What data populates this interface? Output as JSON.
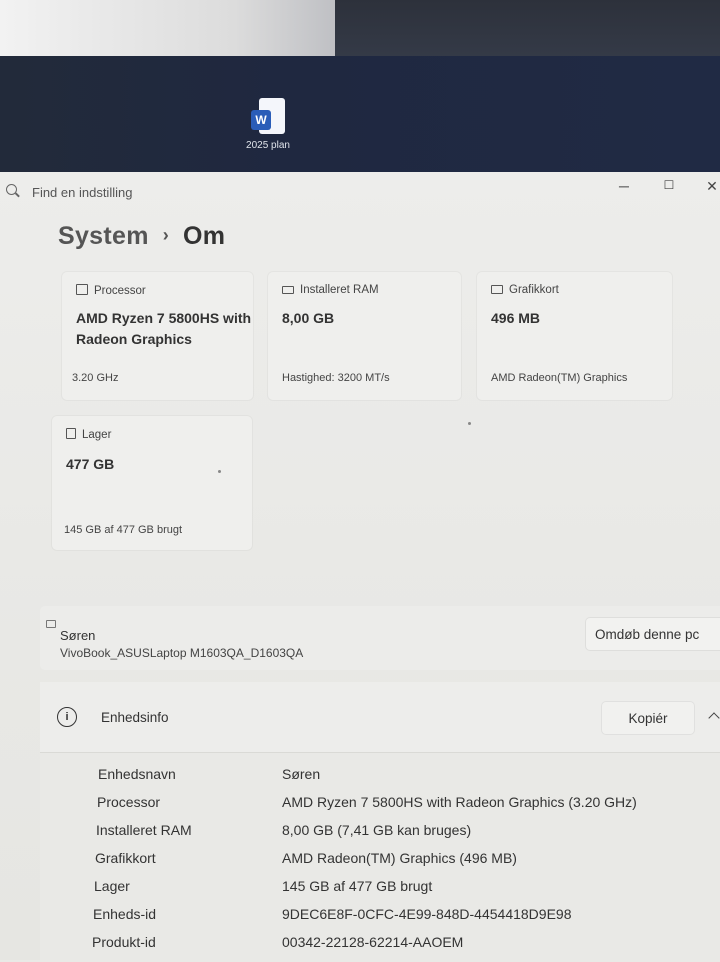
{
  "desktop": {
    "file_icon": "word-icon",
    "file_icon_letter": "W",
    "file_label": "2025 plan"
  },
  "window": {
    "search_placeholder": "Find en indstilling",
    "controls": {
      "minimize": "─",
      "maximize": "☐",
      "close": "✕"
    }
  },
  "breadcrumb": {
    "parent": "System",
    "separator": "›",
    "current": "Om"
  },
  "cards": [
    {
      "id": "processor",
      "icon": "processor-icon",
      "header": "Processor",
      "value": "AMD Ryzen 7 5800HS with Radeon Graphics",
      "sub": "3.20 GHz"
    },
    {
      "id": "ram",
      "icon": "memory-icon",
      "header": "Installeret RAM",
      "value": "8,00 GB",
      "sub": "Hastighed: 3200 MT/s"
    },
    {
      "id": "gpu",
      "icon": "graphics-card-icon",
      "header": "Grafikkort",
      "value": "496 MB",
      "sub": "AMD Radeon(TM) Graphics"
    },
    {
      "id": "storage",
      "icon": "storage-icon",
      "header": "Lager",
      "value": "477 GB",
      "sub": "145 GB af 477 GB brugt"
    }
  ],
  "device": {
    "name": "Søren",
    "model": "VivoBook_ASUSLaptop M1603QA_D1603QA",
    "rename_label": "Omdøb denne pc"
  },
  "device_info": {
    "title": "Enhedsinfo",
    "info_icon_glyph": "i",
    "copy_label": "Kopiér",
    "rows": [
      {
        "label": "Enhedsnavn",
        "value": "Søren"
      },
      {
        "label": "Processor",
        "value": "AMD Ryzen 7 5800HS with Radeon Graphics (3.20 GHz)"
      },
      {
        "label": "Installeret RAM",
        "value": "8,00 GB (7,41 GB kan bruges)"
      },
      {
        "label": "Grafikkort",
        "value": "AMD Radeon(TM) Graphics (496 MB)"
      },
      {
        "label": "Lager",
        "value": "145 GB af 477 GB brugt"
      },
      {
        "label": "Enheds-id",
        "value": "9DEC6E8F-0CFC-4E99-848D-4454418D9E98"
      },
      {
        "label": "Produkt-id",
        "value": "00342-22128-62214-AAOEM"
      }
    ]
  }
}
